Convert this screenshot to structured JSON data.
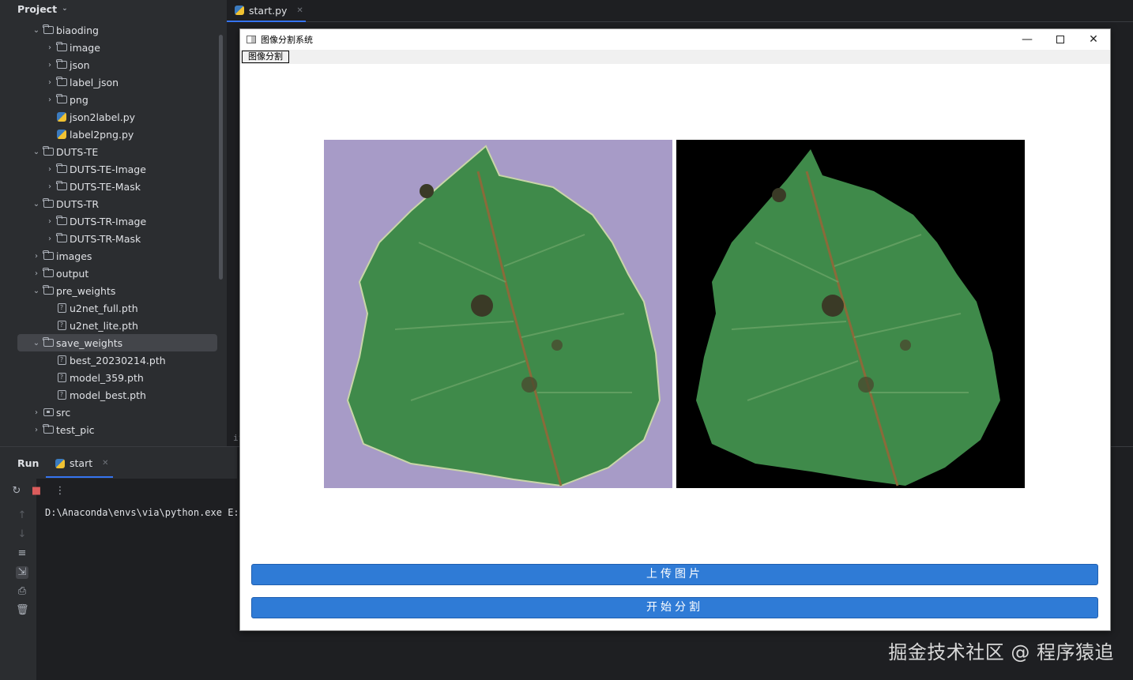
{
  "project_panel": {
    "title": "Project",
    "tree": [
      {
        "label": "biaoding",
        "type": "folder",
        "level": 1,
        "expanded": true
      },
      {
        "label": "image",
        "type": "folder",
        "level": 2,
        "expanded": false
      },
      {
        "label": "json",
        "type": "folder",
        "level": 2,
        "expanded": false
      },
      {
        "label": "label_json",
        "type": "folder",
        "level": 2,
        "expanded": false
      },
      {
        "label": "png",
        "type": "folder",
        "level": 2,
        "expanded": false
      },
      {
        "label": "json2label.py",
        "type": "python",
        "level": 2
      },
      {
        "label": "label2png.py",
        "type": "python",
        "level": 2
      },
      {
        "label": "DUTS-TE",
        "type": "folder",
        "level": 1,
        "expanded": true
      },
      {
        "label": "DUTS-TE-Image",
        "type": "folder",
        "level": 2,
        "expanded": false
      },
      {
        "label": "DUTS-TE-Mask",
        "type": "folder",
        "level": 2,
        "expanded": false
      },
      {
        "label": "DUTS-TR",
        "type": "folder",
        "level": 1,
        "expanded": true
      },
      {
        "label": "DUTS-TR-Image",
        "type": "folder",
        "level": 2,
        "expanded": false
      },
      {
        "label": "DUTS-TR-Mask",
        "type": "folder",
        "level": 2,
        "expanded": false
      },
      {
        "label": "images",
        "type": "folder",
        "level": 1,
        "expanded": false
      },
      {
        "label": "output",
        "type": "folder",
        "level": 1,
        "expanded": false
      },
      {
        "label": "pre_weights",
        "type": "folder",
        "level": 1,
        "expanded": true
      },
      {
        "label": "u2net_full.pth",
        "type": "file",
        "level": 2
      },
      {
        "label": "u2net_lite.pth",
        "type": "file",
        "level": 2
      },
      {
        "label": "save_weights",
        "type": "folder",
        "level": 1,
        "expanded": true,
        "selected": true
      },
      {
        "label": "best_20230214.pth",
        "type": "file",
        "level": 2
      },
      {
        "label": "model_359.pth",
        "type": "file",
        "level": 2
      },
      {
        "label": "model_best.pth",
        "type": "file",
        "level": 2
      },
      {
        "label": "src",
        "type": "package",
        "level": 1,
        "expanded": false
      },
      {
        "label": "test_pic",
        "type": "folder",
        "level": 1,
        "expanded": false
      }
    ]
  },
  "editor": {
    "active_tab": "start.py",
    "code_snippet": "if"
  },
  "run_panel": {
    "label": "Run",
    "tab": "start",
    "console_line": "D:\\Anaconda\\envs\\via\\python.exe E:"
  },
  "app_window": {
    "title": "图像分割系统",
    "menu": [
      "图像分割"
    ],
    "upload_button": "上传图片",
    "segment_button": "开始分割",
    "colors": {
      "button_blue": "#2f7bd6",
      "original_bg": "#a79bc7",
      "mask_bg": "#000000",
      "leaf": "#3f8a4a"
    }
  },
  "watermark": "掘金技术社区 @ 程序猿追"
}
